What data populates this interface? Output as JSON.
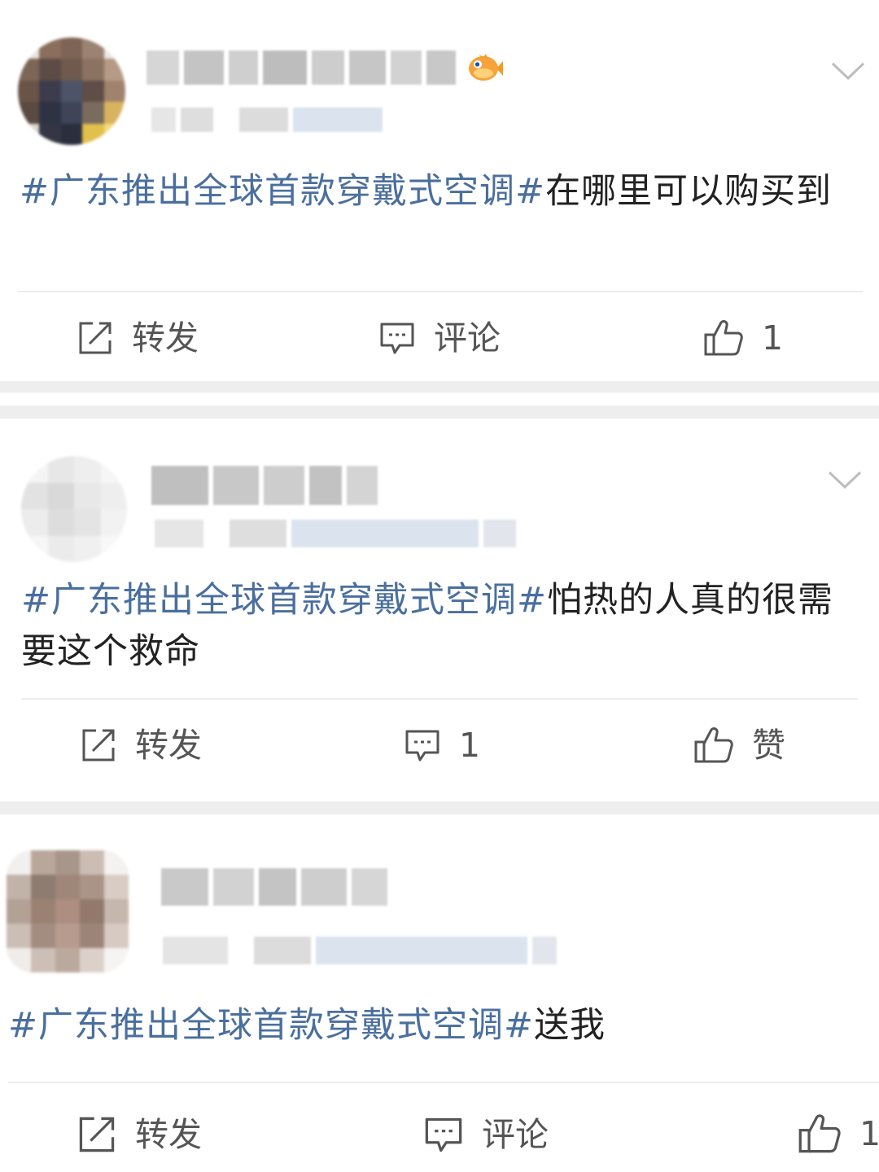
{
  "posts": [
    {
      "id": "post-1",
      "hashtag": "#广东推出全球首款穿戴式空调#",
      "text": "在哪里可以购买到",
      "actions": {
        "repost": "转发",
        "comment": "评论",
        "like": "1"
      }
    },
    {
      "id": "post-2",
      "hashtag": "#广东推出全球首款穿戴式空调#",
      "text": "怕热的人真的很需要这个救命",
      "actions": {
        "repost": "转发",
        "comment": "1",
        "like": "赞"
      }
    },
    {
      "id": "post-3",
      "hashtag": "#广东推出全球首款穿戴式空调#",
      "text": "送我",
      "actions": {
        "repost": "转发",
        "comment": "评论",
        "like": "1"
      }
    }
  ],
  "icons": {
    "repost": "share-edit-icon",
    "comment": "comment-icon",
    "like": "thumbs-up-icon",
    "more": "chevron-down-icon",
    "badge": "fish-badge-icon"
  },
  "colors": {
    "hashtag": "#4a6f9e",
    "text": "#222222",
    "action": "#555555",
    "separator": "#eeeeee"
  }
}
